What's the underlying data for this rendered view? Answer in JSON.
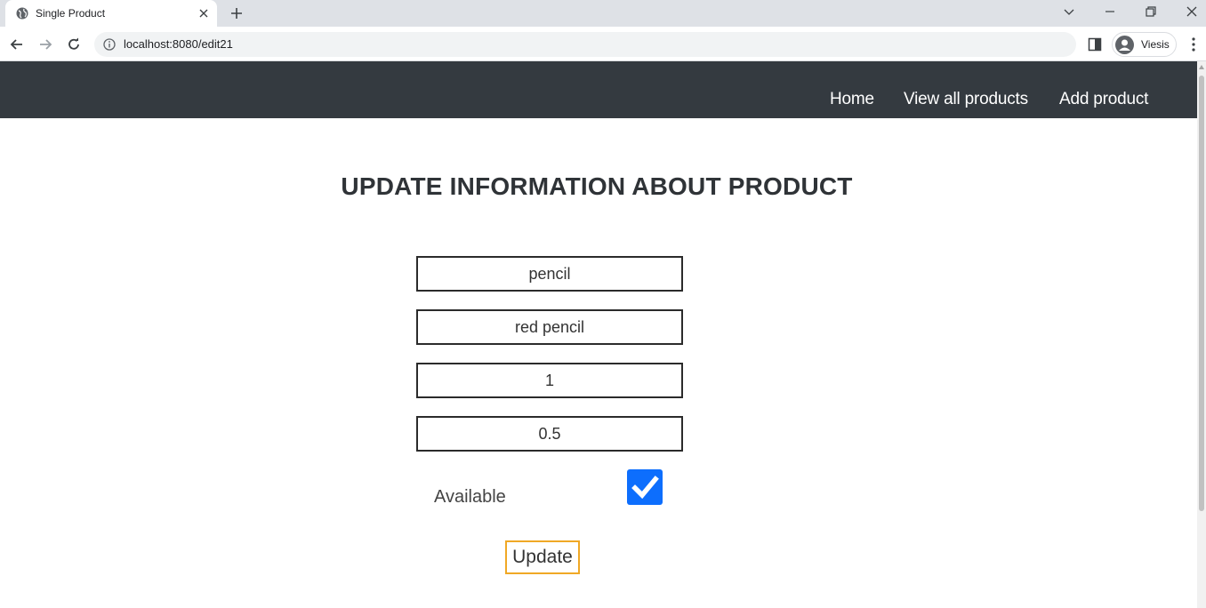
{
  "browser": {
    "tab_title": "Single Product",
    "url": "localhost:8080/edit21",
    "profile_name": "Viesis"
  },
  "navbar": {
    "links": [
      "Home",
      "View all products",
      "Add product"
    ]
  },
  "form": {
    "title": "UPDATE INFORMATION ABOUT PRODUCT",
    "name_value": "pencil",
    "description_value": "red pencil",
    "quantity_value": "1",
    "price_value": "0.5",
    "available_label": "Available",
    "available_checked": true,
    "submit_label": "Update"
  },
  "colors": {
    "navbar_bg": "#343a40",
    "checkbox_accent": "#0d6efd",
    "button_border": "#f0a825"
  },
  "icons": [
    "globe-icon",
    "close-icon",
    "plus-icon",
    "back-icon",
    "forward-icon",
    "reload-icon",
    "info-icon",
    "side-panel-icon",
    "avatar-icon",
    "more-icon",
    "check-icon"
  ]
}
